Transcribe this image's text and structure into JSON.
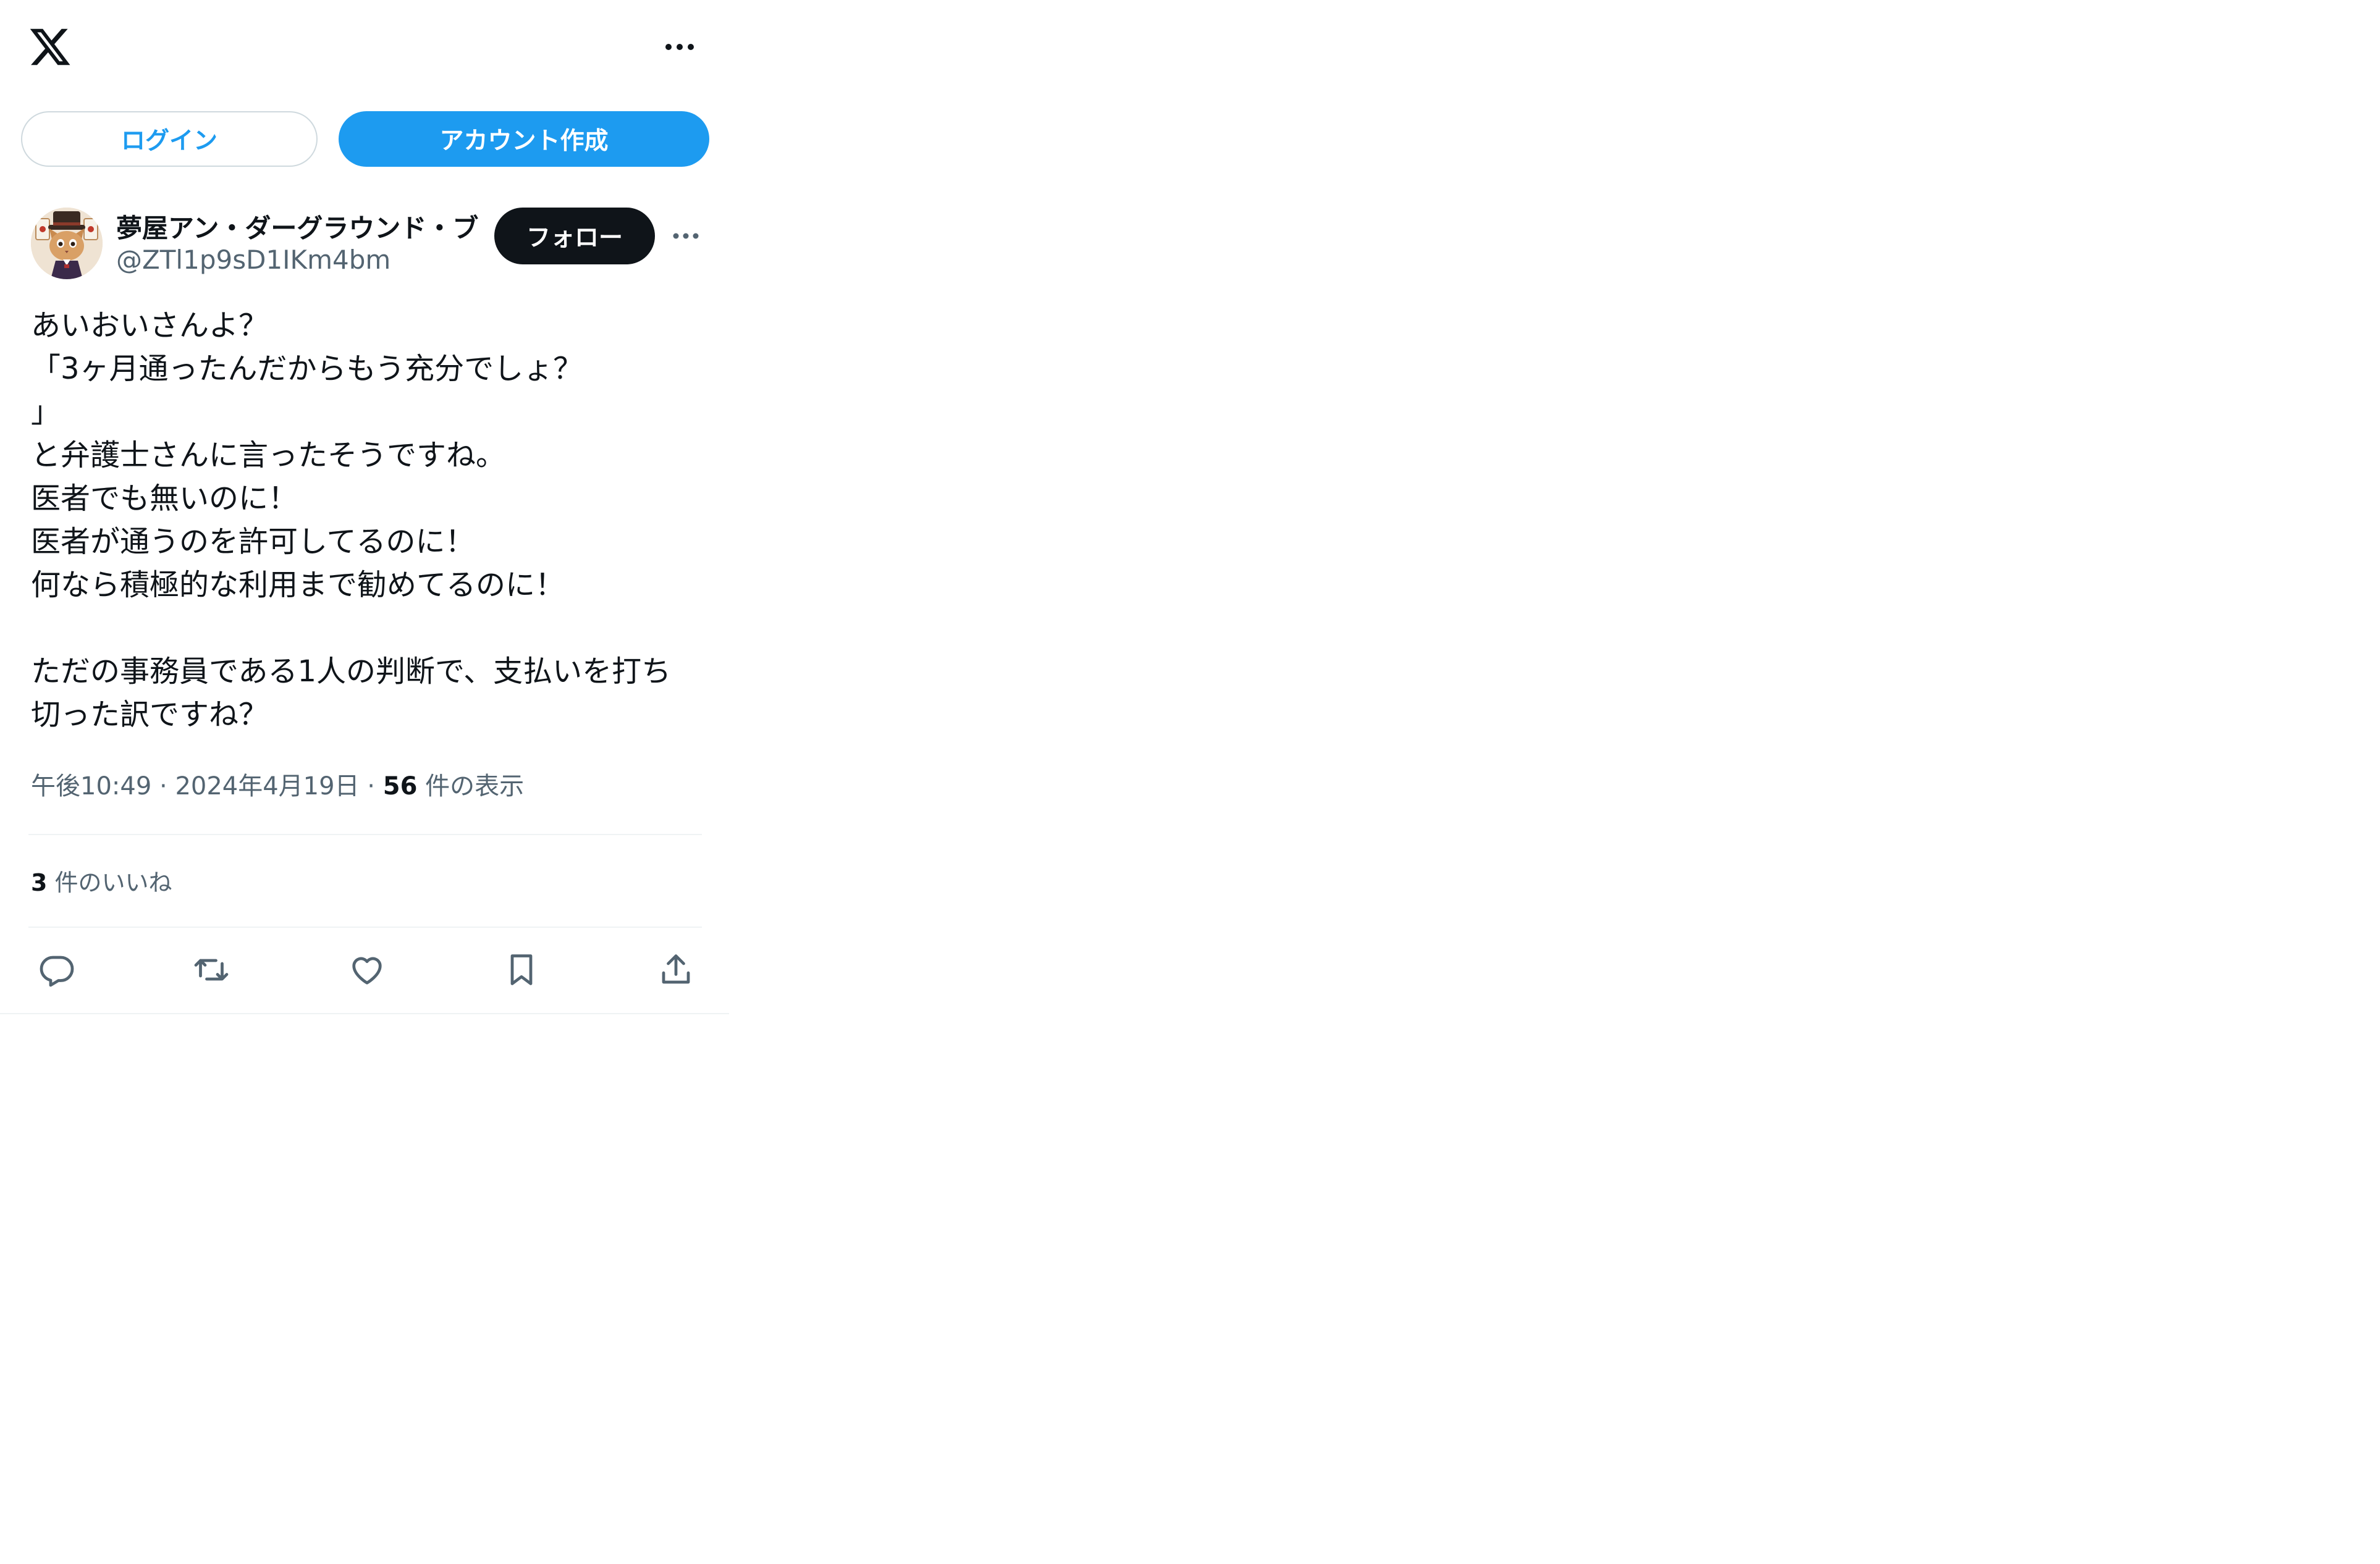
{
  "header": {
    "logo_icon": "x-logo-icon",
    "more_icon": "more-horizontal-icon"
  },
  "auth": {
    "login_label": "ログイン",
    "signup_label": "アカウント作成"
  },
  "tweet": {
    "author": {
      "display_name": "夢屋アン・ダーグラウンド・ブ",
      "handle": "@ZTl1p9sD1IKm4bm",
      "avatar_icon": "avatar-cat-icon"
    },
    "follow_label": "フォロー",
    "text": "あいおいさんよ？\n「3ヶ月通ったんだからもう充分でしょ？\n」\nと弁護士さんに言ったそうですね。\n医者でも無いのに！\n医者が通うのを許可してるのに！\n何なら積極的な利用まで勧めてるのに！\n\nただの事務員である1人の判断で、支払いを打ち切った訳ですね？",
    "time": "午後10:49",
    "date": "2024年4月19日",
    "views_count": "56",
    "views_label": "件の表示",
    "likes_count": "3",
    "likes_label": "件のいいね"
  },
  "actions": [
    {
      "icon": "reply-icon"
    },
    {
      "icon": "retweet-icon"
    },
    {
      "icon": "like-heart-icon"
    },
    {
      "icon": "bookmark-icon"
    },
    {
      "icon": "share-upload-icon"
    }
  ],
  "colors": {
    "accent": "#1d9bf0",
    "text_primary": "#0f1419",
    "text_secondary": "#536471",
    "divider": "#eff3f4",
    "follow_button": "#0f1419"
  }
}
